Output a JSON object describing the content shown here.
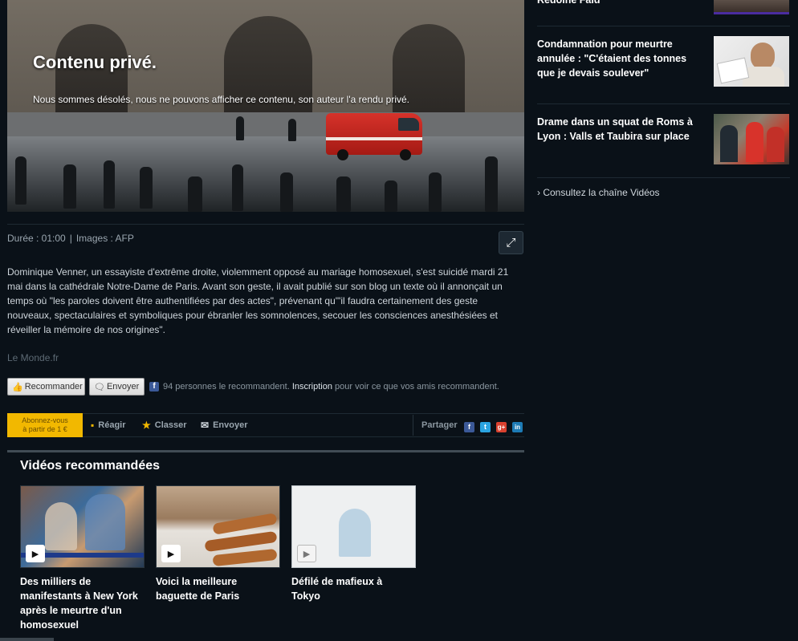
{
  "video": {
    "title": "Contenu privé.",
    "message": "Nous sommes désolés, nous ne pouvons afficher ce contenu, son auteur l'a rendu privé."
  },
  "meta": {
    "duration": "Durée : 01:00",
    "separator": "|",
    "images": "Images : AFP"
  },
  "article": {
    "description": "Dominique Venner, un essayiste d'extrême droite, violemment opposé au mariage homosexuel, s'est suicidé mardi 21 mai dans la cathédrale Notre-Dame de Paris. Avant son geste, il avait publié sur son blog un texte où il annonçait un temps où \"les paroles doivent être authentifiées par des actes\", prévenant qu'\"il faudra certainement des geste nouveaux, spectaculaires et symboliques pour ébranler les somnolences, secouer les consciences anesthésiées et réveiller la mémoire de nos origines\".",
    "source": "Le Monde.fr"
  },
  "facebook": {
    "recommend_label": "Recommander",
    "send_label": "Envoyer",
    "count_text": "94 personnes le recommandent.",
    "signup_link": "Inscription",
    "suffix_text": "pour voir ce que vos amis recommandent."
  },
  "actions": {
    "subscribe_line1": "Abonnez-vous",
    "subscribe_line2": "à partir de 1 €",
    "react": "Réagir",
    "classify": "Classer",
    "send": "Envoyer",
    "share": "Partager"
  },
  "recommended": {
    "title": "Vidéos recommandées",
    "items": [
      {
        "title": "Des milliers de manifestants à New York après le meurtre d'un homosexuel"
      },
      {
        "title": "Voici la meilleure baguette de Paris"
      },
      {
        "title": "Défilé de mafieux à Tokyo"
      }
    ]
  },
  "sidebar": {
    "items": [
      {
        "title": "Redoine Faïd"
      },
      {
        "title": "Condamnation pour meurtre annulée : \"C'étaient des tonnes que je devais soulever\""
      },
      {
        "title": "Drame dans un squat de Roms à Lyon : Valls et Taubira sur place"
      }
    ],
    "channel_link": "Consultez la chaîne Vidéos"
  },
  "colors": {
    "background": "#0a1118",
    "subscribe": "#f2b800",
    "facebook": "#3b5998",
    "twitter": "#2aa3e0",
    "googleplus": "#d9412f",
    "linkedin": "#1d7bb5"
  }
}
